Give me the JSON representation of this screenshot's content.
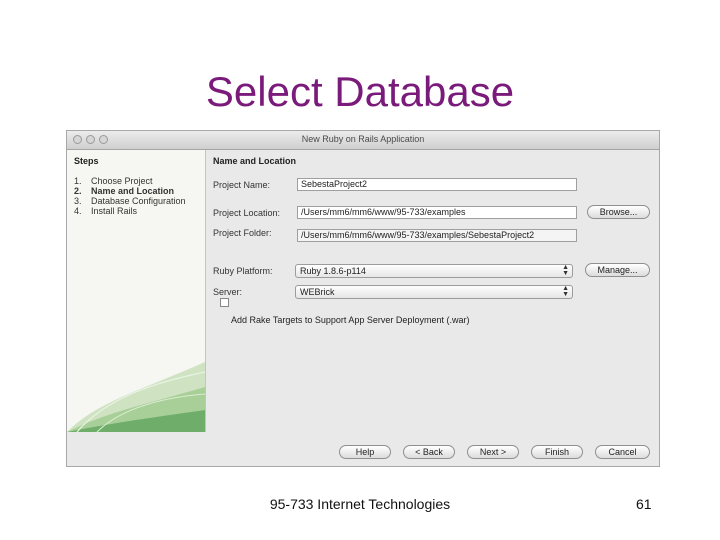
{
  "slide": {
    "title": "Select Database",
    "footer": "95-733 Internet Technologies",
    "page_number": "61"
  },
  "window": {
    "title": "New Ruby on Rails Application"
  },
  "steps": {
    "heading": "Steps",
    "items": [
      {
        "num": "1.",
        "label": "Choose Project",
        "current": false
      },
      {
        "num": "2.",
        "label": "Name and Location",
        "current": true
      },
      {
        "num": "3.",
        "label": "Database Configuration",
        "current": false
      },
      {
        "num": "4.",
        "label": "Install Rails",
        "current": false
      }
    ]
  },
  "form": {
    "heading": "Name and Location",
    "project_name_label": "Project Name:",
    "project_name_value": "SebestaProject2",
    "project_location_label": "Project Location:",
    "project_location_value": "/Users/mm6/mm6/www/95-733/examples",
    "project_folder_label": "Project Folder:",
    "project_folder_value": "/Users/mm6/mm6/www/95-733/examples/SebestaProject2",
    "browse_label": "Browse...",
    "ruby_platform_label": "Ruby Platform:",
    "ruby_platform_value": "Ruby 1.8.6-p114",
    "manage_label": "Manage...",
    "server_label": "Server:",
    "server_value": "WEBrick",
    "rake_checkbox_label": "Add Rake Targets to Support App Server Deployment (.war)",
    "rake_checkbox_checked": false
  },
  "buttons": {
    "help": "Help",
    "back": "< Back",
    "next": "Next >",
    "finish": "Finish",
    "cancel": "Cancel"
  },
  "colors": {
    "title": "#7a1a7a",
    "window_bg": "#e9e9e9"
  }
}
